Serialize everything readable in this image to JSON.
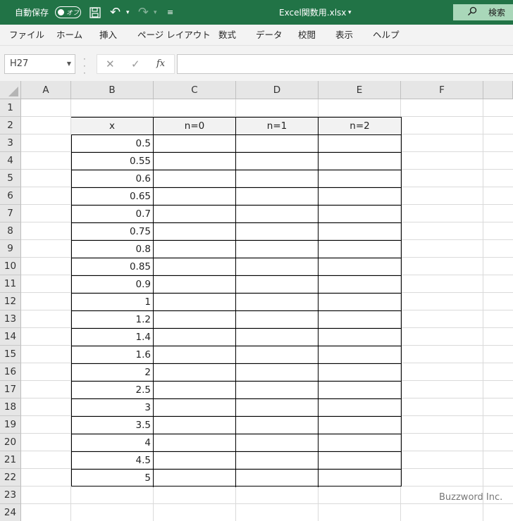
{
  "titlebar": {
    "autosave_label": "自動保存",
    "autosave_state": "オフ",
    "doc_title": "Excel関数用.xlsx",
    "search_label": "検索"
  },
  "menu": [
    "ファイル",
    "ホーム",
    "挿入",
    "ページ レイアウト",
    "数式",
    "データ",
    "校閲",
    "表示",
    "ヘルプ"
  ],
  "formula_bar": {
    "name_box": "H27",
    "cancel_symbol": "✕",
    "enter_symbol": "✓",
    "fx_label": "fx",
    "formula": ""
  },
  "columns": [
    "A",
    "B",
    "C",
    "D",
    "E",
    "F"
  ],
  "rows": [
    "1",
    "2",
    "3",
    "4",
    "5",
    "6",
    "7",
    "8",
    "9",
    "10",
    "11",
    "12",
    "13",
    "14",
    "15",
    "16",
    "17",
    "18",
    "19",
    "20",
    "21",
    "22",
    "23",
    "24"
  ],
  "table": {
    "headers": [
      "x",
      "n=0",
      "n=1",
      "n=2"
    ],
    "x_values": [
      "0.5",
      "0.55",
      "0.6",
      "0.65",
      "0.7",
      "0.75",
      "0.8",
      "0.85",
      "0.9",
      "1",
      "1.2",
      "1.4",
      "1.6",
      "2",
      "2.5",
      "3",
      "3.5",
      "4",
      "4.5",
      "5"
    ]
  },
  "watermark": "Buzzword Inc.",
  "colors": {
    "title_bar": "#217346",
    "search_box": "#a9d7b9",
    "header_fill": "#e6e6e6"
  }
}
